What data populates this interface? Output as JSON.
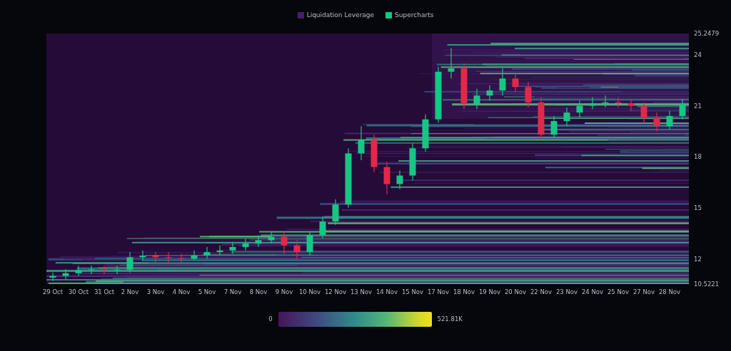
{
  "legend": [
    {
      "label": "Liquidation Leverage",
      "color": "#4a1f66"
    },
    {
      "label": "Supercharts",
      "color": "#16c784"
    }
  ],
  "chart": {
    "chart_data": {
      "type": "candlestick",
      "categories": [
        "29 Oct",
        null,
        "30 Oct",
        null,
        "31 Oct",
        null,
        "2 Nov",
        null,
        "3 Nov",
        null,
        "4 Nov",
        null,
        "5 Nov",
        null,
        "7 Nov",
        null,
        "8 Nov",
        null,
        "9 Nov",
        null,
        "10 Nov",
        null,
        "12 Nov",
        null,
        "13 Nov",
        null,
        "14 Nov",
        null,
        "15 Nov",
        null,
        "17 Nov",
        null,
        "18 Nov",
        null,
        "19 Nov",
        null,
        "20 Nov",
        null,
        "22 Nov",
        null,
        "23 Nov",
        null,
        "24 Nov",
        null,
        "25 Nov",
        null,
        "27 Nov",
        null,
        "28 Nov",
        null
      ],
      "ohlc": [
        [
          10.9,
          11.2,
          10.7,
          11.0
        ],
        [
          11.0,
          11.4,
          10.8,
          11.16
        ],
        [
          11.16,
          11.6,
          11.0,
          11.33
        ],
        [
          11.33,
          11.6,
          11.1,
          11.38
        ],
        [
          11.38,
          11.6,
          11.1,
          11.34
        ],
        [
          11.34,
          11.6,
          11.1,
          11.37
        ],
        [
          11.37,
          12.4,
          11.2,
          12.1
        ],
        [
          12.1,
          12.5,
          11.9,
          12.2
        ],
        [
          12.2,
          12.4,
          11.8,
          12.1
        ],
        [
          12.1,
          12.4,
          11.8,
          12.05
        ],
        [
          12.05,
          12.3,
          11.8,
          12.01
        ],
        [
          12.01,
          12.5,
          11.9,
          12.2
        ],
        [
          12.2,
          12.7,
          12.0,
          12.4
        ],
        [
          12.4,
          12.8,
          12.2,
          12.5
        ],
        [
          12.5,
          13.0,
          12.3,
          12.7
        ],
        [
          12.7,
          13.2,
          12.5,
          12.9
        ],
        [
          12.9,
          13.4,
          12.7,
          13.1
        ],
        [
          13.1,
          13.6,
          12.9,
          13.3
        ],
        [
          13.3,
          13.6,
          12.3,
          12.8
        ],
        [
          12.8,
          13.1,
          12.0,
          12.4
        ],
        [
          12.4,
          13.6,
          12.2,
          13.4
        ],
        [
          13.4,
          14.5,
          13.2,
          14.2
        ],
        [
          14.2,
          15.5,
          14.0,
          15.2
        ],
        [
          15.2,
          18.5,
          15.0,
          18.2
        ],
        [
          18.2,
          19.8,
          17.8,
          19.0
        ],
        [
          19.0,
          19.3,
          17.1,
          17.4
        ],
        [
          17.4,
          17.7,
          15.8,
          16.4
        ],
        [
          16.4,
          17.2,
          16.1,
          16.9
        ],
        [
          16.9,
          18.8,
          16.6,
          18.5
        ],
        [
          18.5,
          20.5,
          18.3,
          20.2
        ],
        [
          20.2,
          23.3,
          20.0,
          23.0
        ],
        [
          23.0,
          24.4,
          22.6,
          23.2
        ],
        [
          23.2,
          23.5,
          20.8,
          21.1
        ],
        [
          21.1,
          22.0,
          20.8,
          21.6
        ],
        [
          21.6,
          22.2,
          21.3,
          21.9
        ],
        [
          21.9,
          23.2,
          21.6,
          22.6
        ],
        [
          22.6,
          22.9,
          21.8,
          22.1
        ],
        [
          22.1,
          22.4,
          20.9,
          21.2
        ],
        [
          21.2,
          21.5,
          19.0,
          19.3
        ],
        [
          19.3,
          20.4,
          19.1,
          20.1
        ],
        [
          20.1,
          20.9,
          19.8,
          20.6
        ],
        [
          20.6,
          21.3,
          20.3,
          21.0
        ],
        [
          21.0,
          21.5,
          20.8,
          21.15
        ],
        [
          21.15,
          21.6,
          20.9,
          21.2
        ],
        [
          21.2,
          21.5,
          20.9,
          21.15
        ],
        [
          21.15,
          21.4,
          20.7,
          21.0
        ],
        [
          21.0,
          21.2,
          20.0,
          20.3
        ],
        [
          20.3,
          20.6,
          19.5,
          19.8
        ],
        [
          19.8,
          20.7,
          19.6,
          20.4
        ],
        [
          20.4,
          21.4,
          20.2,
          21.1
        ]
      ],
      "ylim": [
        10.5221,
        25.2479
      ],
      "yticks": [
        {
          "value": 25.2479,
          "label": "25.2479"
        },
        24,
        21,
        18,
        15,
        12,
        {
          "value": 10.5221,
          "label": "10.5221"
        }
      ]
    }
  },
  "color_scale": {
    "min_label": "0",
    "max_label": "521.81K"
  }
}
